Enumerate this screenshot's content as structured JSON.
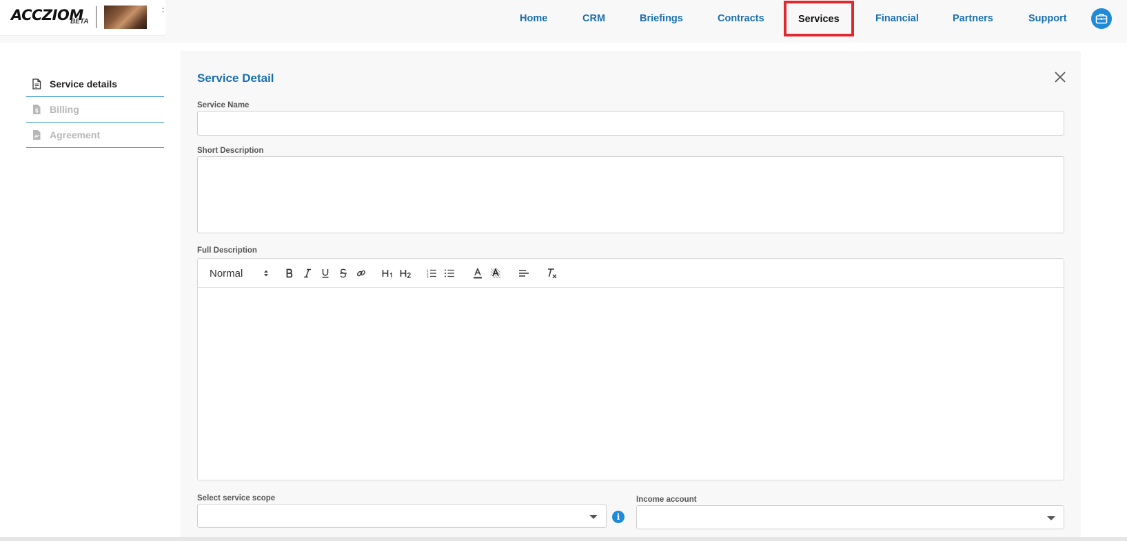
{
  "header": {
    "logo_text": "ACCZIOM",
    "logo_badge": "BETA",
    "nav": [
      {
        "label": "Home"
      },
      {
        "label": "CRM"
      },
      {
        "label": "Briefings"
      },
      {
        "label": "Contracts"
      },
      {
        "label": "Services",
        "active": true
      },
      {
        "label": "Financial"
      },
      {
        "label": "Partners"
      },
      {
        "label": "Support"
      }
    ]
  },
  "sidebar": {
    "items": [
      {
        "label": "Service details",
        "icon": "document-icon",
        "state": "active"
      },
      {
        "label": "Billing",
        "icon": "invoice-icon",
        "state": "disabled"
      },
      {
        "label": "Agreement",
        "icon": "signature-doc-icon",
        "state": "disabled"
      }
    ]
  },
  "panel": {
    "title": "Service Detail",
    "service_name_label": "Service Name",
    "service_name_value": "",
    "short_description_label": "Short Description",
    "short_description_value": "",
    "full_description_label": "Full Description",
    "editor": {
      "format_value": "Normal"
    },
    "scope_label": "Select service scope",
    "scope_value": "",
    "income_label": "Income account",
    "income_value": "",
    "info_glyph": "i"
  },
  "colors": {
    "accent": "#1a6fb0",
    "highlight_border": "#e0282e",
    "divider": "#2a8fd4"
  }
}
